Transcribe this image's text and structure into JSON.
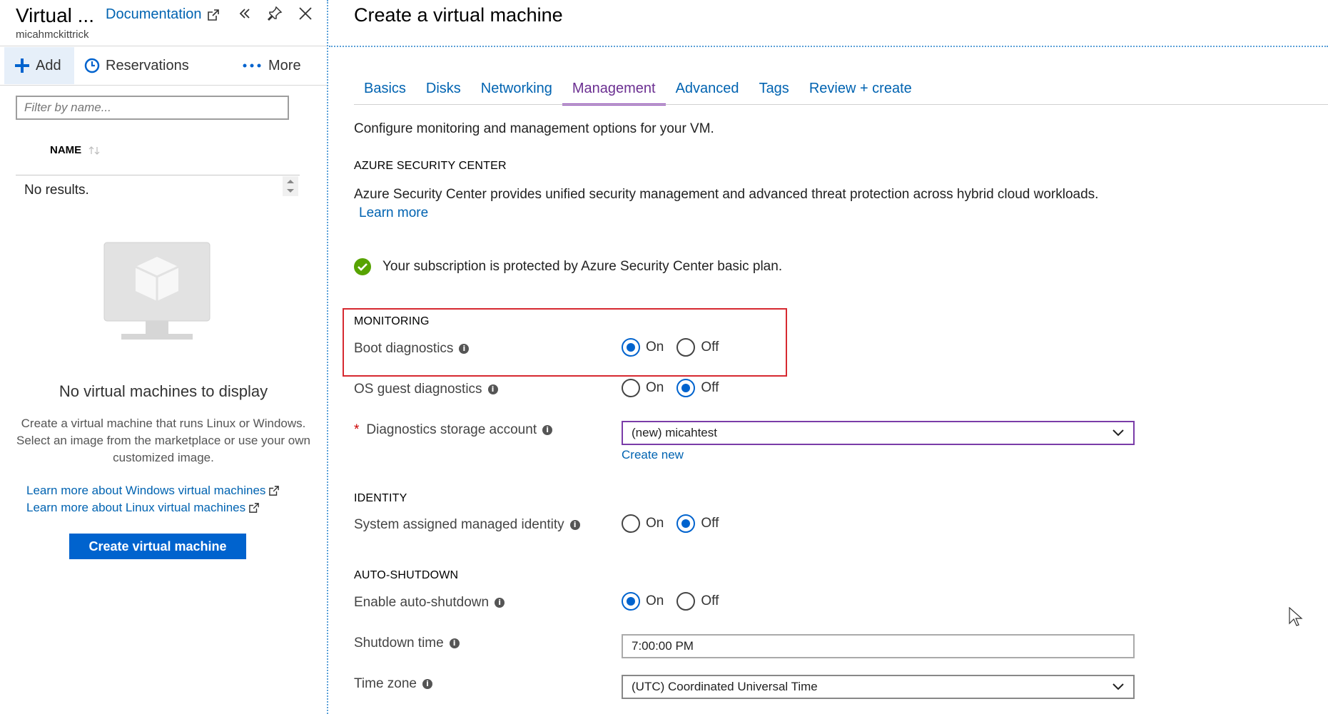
{
  "left_blade": {
    "title": "Virtual ...",
    "subtitle": "micahmckittrick",
    "documentation_link": "Documentation",
    "toolbar": {
      "add": "Add",
      "reservations": "Reservations",
      "more": "More"
    },
    "filter_placeholder": "Filter by name...",
    "column_name": "NAME",
    "no_results": "No results.",
    "empty_title": "No virtual machines to display",
    "empty_description": "Create a virtual machine that runs Linux or Windows. Select an image from the marketplace or use your own customized image.",
    "link_windows": "Learn more about Windows virtual machines",
    "link_linux": "Learn more about Linux virtual machines",
    "create_button": "Create virtual machine"
  },
  "right_blade": {
    "title": "Create a virtual machine",
    "tabs": [
      {
        "label": "Basics",
        "active": false
      },
      {
        "label": "Disks",
        "active": false
      },
      {
        "label": "Networking",
        "active": false
      },
      {
        "label": "Management",
        "active": true
      },
      {
        "label": "Advanced",
        "active": false
      },
      {
        "label": "Tags",
        "active": false
      },
      {
        "label": "Review + create",
        "active": false
      }
    ],
    "description": "Configure monitoring and management options for your VM.",
    "asc": {
      "heading": "AZURE SECURITY CENTER",
      "text": "Azure Security Center provides unified security management and advanced threat protection across hybrid cloud workloads.",
      "learn_more": "Learn more",
      "status": "Your subscription is protected by Azure Security Center basic plan."
    },
    "monitoring": {
      "heading": "MONITORING",
      "boot_diagnostics": {
        "label": "Boot diagnostics",
        "value": "On"
      },
      "os_guest_diagnostics": {
        "label": "OS guest diagnostics",
        "value": "Off"
      },
      "storage_account": {
        "label": "Diagnostics storage account",
        "value": "(new) micahtest",
        "create_new": "Create new"
      }
    },
    "identity": {
      "heading": "IDENTITY",
      "system_identity": {
        "label": "System assigned managed identity",
        "value": "Off"
      }
    },
    "auto_shutdown": {
      "heading": "AUTO-SHUTDOWN",
      "enable": {
        "label": "Enable auto-shutdown",
        "value": "On"
      },
      "time": {
        "label": "Shutdown time",
        "value": "7:00:00 PM"
      },
      "timezone": {
        "label": "Time zone",
        "value": "(UTC) Coordinated Universal Time"
      }
    },
    "radio_on": "On",
    "radio_off": "Off"
  },
  "colors": {
    "accent": "#0063ce",
    "link": "#0063b1",
    "active_tab": "#8a3fb5",
    "highlight_box": "#d62930",
    "success": "#57a300"
  }
}
